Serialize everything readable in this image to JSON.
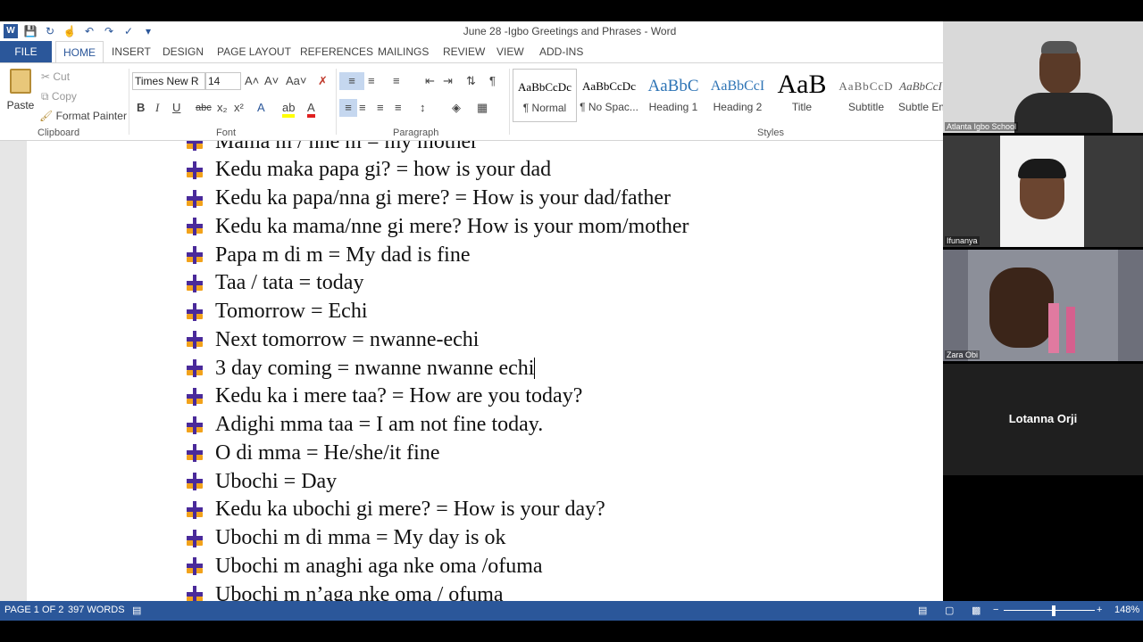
{
  "window": {
    "title": "June 28 -Igbo Greetings and Phrases - Word"
  },
  "tabs": [
    "FILE",
    "HOME",
    "INSERT",
    "DESIGN",
    "PAGE LAYOUT",
    "REFERENCES",
    "MAILINGS",
    "REVIEW",
    "VIEW",
    "ADD-INS"
  ],
  "ribbon": {
    "clipboard": {
      "paste": "Paste",
      "cut": "Cut",
      "copy": "Copy",
      "format_painter": "Format Painter",
      "label": "Clipboard"
    },
    "font": {
      "name": "Times New R",
      "size": "14",
      "label": "Font",
      "grow": "A˄",
      "shrink": "A˅",
      "case": "Aa˅",
      "bold": "B",
      "italic": "I",
      "underline": "U",
      "strike": "abc",
      "subscript": "x₂",
      "superscript": "x²"
    },
    "paragraph": {
      "label": "Paragraph"
    },
    "styles": {
      "label": "Styles",
      "items": [
        {
          "preview": "AaBbCcDc",
          "name": "¶ Normal"
        },
        {
          "preview": "AaBbCcDc",
          "name": "¶ No Spac..."
        },
        {
          "preview": "AaBbC",
          "name": "Heading 1"
        },
        {
          "preview": "AaBbCcI",
          "name": "Heading 2"
        },
        {
          "preview": "AaB",
          "name": "Title"
        },
        {
          "preview": "AaBbCcD",
          "name": "Subtitle"
        },
        {
          "preview": "AaBbCcI",
          "name": "Subtle Em"
        }
      ]
    }
  },
  "document": {
    "lines": [
      "Mama m / nne m = my mother",
      "Kedu maka papa gi? = how is your dad",
      "Kedu ka papa/nna gi mere? = How is your dad/father",
      "Kedu ka mama/nne gi mere? How is your mom/mother",
      "Papa m di m = My dad is fine",
      "Taa / tata = today",
      "Tomorrow = Echi",
      "Next tomorrow = nwanne-echi",
      "3 day coming = nwanne nwanne echi",
      "Kedu ka i mere taa? = How are you today?",
      "Adighi mma taa = I am not fine today.",
      "O di mma = He/she/it fine",
      "Ubochi = Day",
      "Kedu ka ubochi gi mere? = How is your day?",
      "Ubochi m di mma = My day is ok",
      "Ubochi m anaghi aga nke oma /ofuma",
      "Ubochi m n’aga nke oma / ofuma"
    ],
    "cursor_line": 8
  },
  "status": {
    "page": "PAGE 1 OF 2",
    "words": "397 WORDS",
    "zoom": "148%",
    "zoom_minus": "−",
    "zoom_plus": "+"
  },
  "participants": [
    {
      "name": "Atlanta Igbo School",
      "bg": "#d9d9d9"
    },
    {
      "name": "Ifunanya",
      "bg": "#3a3a3a"
    },
    {
      "name": "Zara Obi",
      "bg": "#6d6f7a"
    },
    {
      "name": "Lotanna Orji",
      "bg": "#1f1f1f"
    }
  ],
  "colors": {
    "accent": "#2b579a",
    "bullet_purple": "#4a2a9a",
    "bullet_orange": "#f2a21b"
  }
}
